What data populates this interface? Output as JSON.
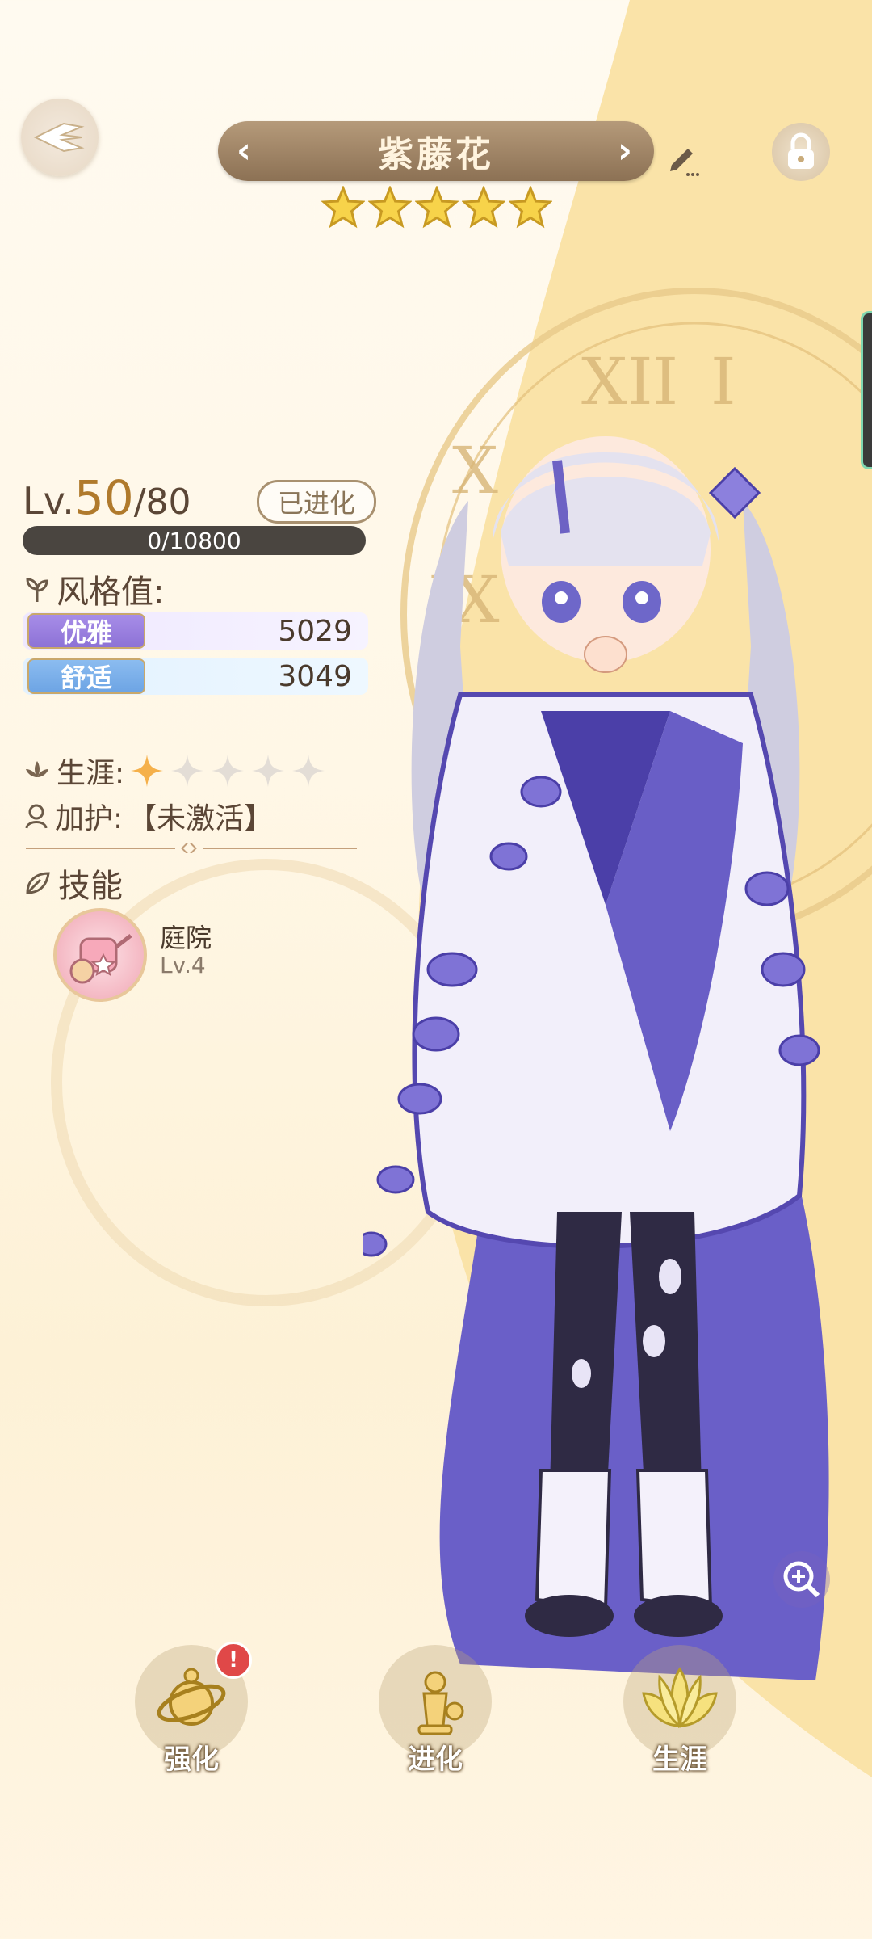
{
  "header": {
    "character_name": "紫藤花",
    "prev_arrow": "‹",
    "next_arrow": "›",
    "rarity_stars": 5
  },
  "level": {
    "prefix": "Lv.",
    "current": "50",
    "max": "/80",
    "evolved_badge": "已进化",
    "exp_text": "0/10800",
    "exp_fraction": 0
  },
  "style": {
    "label": "风格值:",
    "stats": [
      {
        "tag": "优雅",
        "value": "5029"
      },
      {
        "tag": "舒适",
        "value": "3049"
      }
    ]
  },
  "career": {
    "label": "生涯:",
    "filled": 1,
    "total": 5
  },
  "guard": {
    "label": "加护:",
    "value": "【未激活】"
  },
  "skills": {
    "label": "技能",
    "items": [
      {
        "name": "庭院",
        "level": "Lv.4"
      }
    ]
  },
  "bottom_nav": {
    "strengthen": "强化",
    "evolve": "进化",
    "career": "生涯",
    "badge": "!"
  },
  "colors": {
    "accent_gold": "#b07a2c",
    "elegant_purple": "#8d72d6",
    "comfort_blue": "#6da4e4",
    "alert_red": "#e04848"
  }
}
